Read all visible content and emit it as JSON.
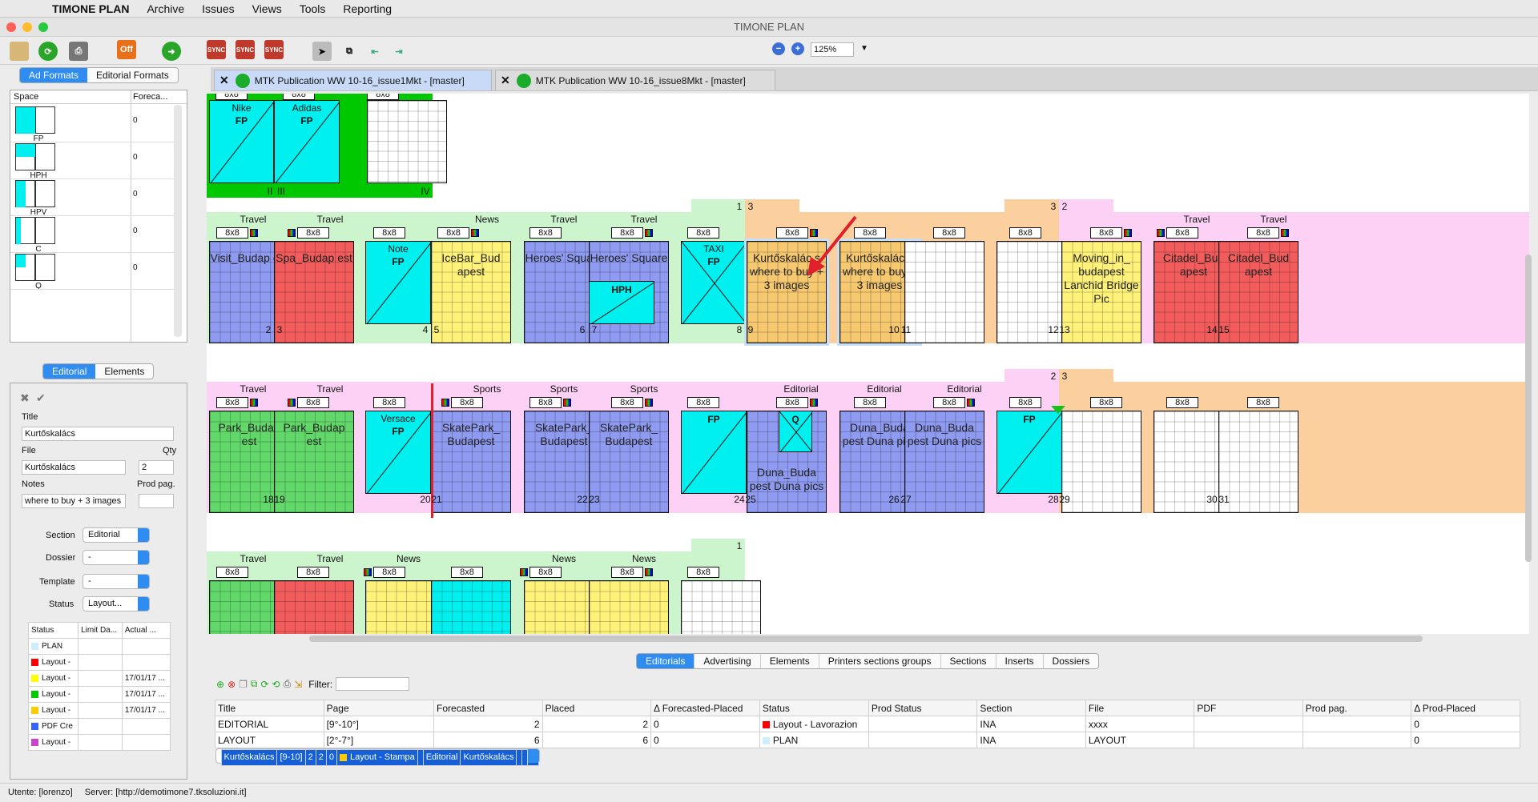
{
  "menu": {
    "app": "TIMONE PLAN",
    "items": [
      "Archive",
      "Issues",
      "Views",
      "Tools",
      "Reporting"
    ]
  },
  "window": {
    "title": "TIMONE PLAN"
  },
  "toolbar": {
    "zoom": "125%",
    "off_label": "Off",
    "sync_label": "SYNC"
  },
  "left": {
    "tabs": [
      "Ad Formats",
      "Editorial Formats"
    ],
    "formats_header": [
      "Space",
      "Foreca..."
    ],
    "formats": [
      {
        "name": "FP",
        "forecast": "0"
      },
      {
        "name": "HPH",
        "forecast": "0"
      },
      {
        "name": "HPV",
        "forecast": "0"
      },
      {
        "name": "C",
        "forecast": "0"
      },
      {
        "name": "Q",
        "forecast": "0"
      }
    ],
    "editor_tabs": [
      "Editorial",
      "Elements"
    ],
    "title_label": "Title",
    "title_value": "Kurtőskalács",
    "file_label": "File",
    "file_value": "Kurtőskalács",
    "qty_label": "Qty",
    "qty_value": "2",
    "notes_label": "Notes",
    "notes_value": "where to buy + 3 images",
    "prodpag_label": "Prod pag.",
    "section_label": "Section",
    "section_value": "Editorial",
    "dossier_label": "Dossier",
    "dossier_value": "-",
    "template_label": "Template",
    "template_value": "-",
    "status_label": "Status",
    "status_value": "Layout...",
    "status_header": [
      "Status",
      "Limit Da...",
      "Actual ..."
    ],
    "status_rows": [
      {
        "color": "#cceeff",
        "name": "PLAN",
        "limit": "",
        "actual": ""
      },
      {
        "color": "#ff0000",
        "name": "Layout -",
        "limit": "",
        "actual": ""
      },
      {
        "color": "#ffff00",
        "name": "Layout -",
        "limit": "",
        "actual": "17/01/17 ..."
      },
      {
        "color": "#00cc00",
        "name": "Layout -",
        "limit": "",
        "actual": "17/01/17 ..."
      },
      {
        "color": "#ffcc00",
        "name": "Layout -",
        "limit": "",
        "actual": "17/01/17 ..."
      },
      {
        "color": "#3366ff",
        "name": "PDF Cre",
        "limit": "",
        "actual": ""
      },
      {
        "color": "#cc44cc",
        "name": "Layout -",
        "limit": "",
        "actual": ""
      }
    ]
  },
  "doc_tabs": [
    "MTK Publication WW 10-16_issue1Mkt - [master]",
    "MTK Publication WW 10-16_issue8Mkt - [master]"
  ],
  "plan": {
    "tag": "8x8",
    "cover": [
      {
        "num": "II",
        "ad": "Nike",
        "fmt": "FP"
      },
      {
        "num": "III",
        "ad": "Adidas",
        "fmt": "FP"
      },
      {
        "num": "IV"
      }
    ],
    "row1_marks": [
      "1",
      "3",
      "3",
      "2"
    ],
    "row1_sections": [
      "Travel",
      "Travel",
      "News",
      "Travel",
      "Travel",
      "Travel",
      "Travel"
    ],
    "row1_pages": [
      "2",
      "3",
      "4",
      "5",
      "6",
      "7",
      "8",
      "9",
      "10",
      "11",
      "12",
      "13",
      "14",
      "15"
    ],
    "row1_titles": {
      "p2": "Visit_Budap est",
      "p3": "Spa_Budap est",
      "p5": "IceBar_Bud apest",
      "p6": "Heroes' Square",
      "p7": "Heroes' Square",
      "p9": "Kurtőskalác s where to buy + 3 images",
      "p10": "Kurtőskalác s where to buy + 3 images",
      "p13": "Moving_in_ budapest Lanchid Bridge Pic",
      "p14": "Citadel_Bud apest",
      "p15": "Citadel_Bud apest"
    },
    "row1_ads": {
      "p4_name": "Note",
      "p4_fmt": "FP",
      "p7_fmt": "HPH",
      "p8_name": "TAXI",
      "p8_fmt": "FP"
    },
    "row2_marks": [
      "2",
      "3"
    ],
    "row2_sections": [
      "Travel",
      "Travel",
      "Sports",
      "Sports",
      "Sports",
      "Editorial",
      "Editorial",
      "Editorial"
    ],
    "row2_pages": [
      "18",
      "19",
      "20",
      "21",
      "22",
      "23",
      "24",
      "25",
      "26",
      "27",
      "28",
      "29",
      "30",
      "31"
    ],
    "row2_titles": {
      "p18": "Park_Budap est",
      "p19": "Park_Budap est",
      "p21": "SkatePark_ Budapest",
      "p22": "SkatePark_ Budapest",
      "p23": "SkatePark_ Budapest",
      "p25": "Duna_Buda pest Duna pics",
      "p26": "Duna_Buda pest Duna pics",
      "p27": "Duna_Buda pest Duna pics"
    },
    "row2_ads": {
      "p20_name": "Versace",
      "p20_fmt": "FP",
      "p24_fmt": "FP",
      "p25_fmt": "Q",
      "p28_fmt": "FP"
    },
    "row3_marks": [
      "1"
    ],
    "row3_sections": [
      "Travel",
      "Travel",
      "News",
      "News",
      "News"
    ]
  },
  "bottom": {
    "tabs": [
      "Editorials",
      "Advertising",
      "Elements",
      "Printers sections groups",
      "Sections",
      "Inserts",
      "Dossiers"
    ],
    "filter_label": "Filter:",
    "columns": [
      "Title",
      "Page",
      "Forecasted",
      "Placed",
      "Δ Forecasted-Placed",
      "Status",
      "Prod Status",
      "Section",
      "File",
      "PDF",
      "Prod pag.",
      "Δ Prod-Placed"
    ],
    "rows": [
      {
        "title": "EDITORIAL",
        "page": "[9°-10°]",
        "forecasted": "2",
        "placed": "2",
        "delta": "0",
        "status": "Layout - Lavorazion",
        "status_color": "#ff0000",
        "prod": "",
        "section": "INA",
        "file": "xxxx",
        "pdf": "",
        "prodpag": "",
        "delta2": "0"
      },
      {
        "title": "LAYOUT",
        "page": "[2°-7°]",
        "forecasted": "6",
        "placed": "6",
        "delta": "0",
        "status": "PLAN",
        "status_color": "#cceeff",
        "prod": "",
        "section": "INA",
        "file": "LAYOUT",
        "pdf": "",
        "prodpag": "",
        "delta2": "0"
      },
      {
        "title": "Kurtőskalács",
        "page": "[9-10]",
        "forecasted": "2",
        "placed": "2",
        "delta": "0",
        "status": "Layout - Stampa",
        "status_color": "#ffcc00",
        "prod": "",
        "section": "Editorial",
        "file": "Kurtőskalács",
        "pdf": "",
        "prodpag": "",
        "delta2": "0"
      }
    ]
  },
  "status": {
    "user": "Utente: [lorenzo]",
    "server": "Server: [http://demotimone7.tksoluzioni.it]"
  },
  "colors": {
    "accent": "#2f8cf0",
    "cyan": "#00f0f0",
    "blue_page": "#8e9bf0",
    "red_page": "#f25c5c",
    "yellow_page": "#fff27a",
    "green_page": "#62d86a",
    "orange_page": "#f6c870",
    "green_bg": "#cdf5cd",
    "pink_bg": "#fdd0f5",
    "orange_bg": "#fbcf9e"
  }
}
